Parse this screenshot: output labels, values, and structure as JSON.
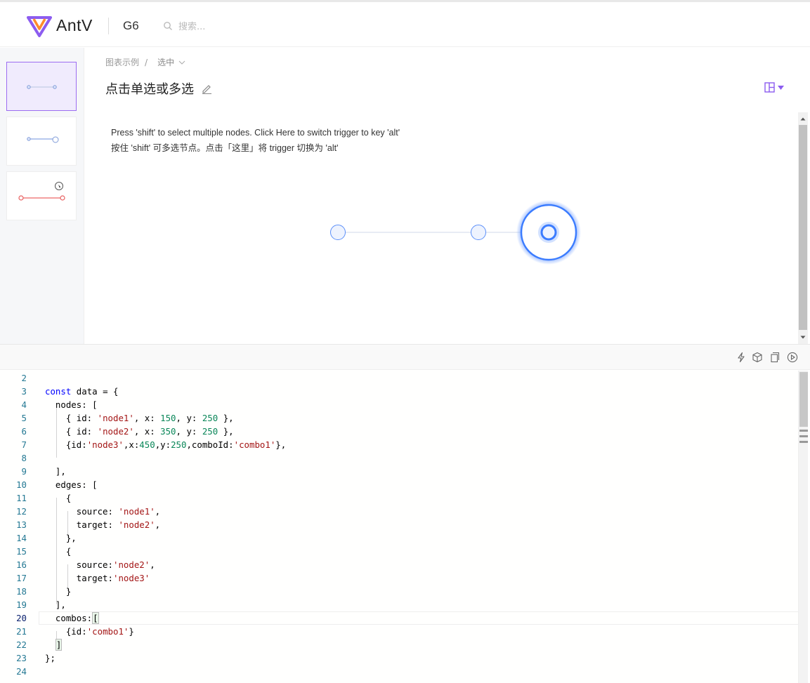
{
  "header": {
    "brand": "AntV",
    "product": "G6",
    "search_placeholder": "搜索..."
  },
  "breadcrumb": {
    "root": "图表示例",
    "separator": "/",
    "current": "选中"
  },
  "page_title": "点击单选或多选",
  "description": {
    "line1": "Press 'shift' to select multiple nodes. Click Here to switch trigger to key 'alt'",
    "line2": "按住 'shift' 可多选节点。点击「这里」将 trigger 切换为 'alt'"
  },
  "colors": {
    "accent": "#8c5cf0",
    "node_stroke": "#5b8ff9",
    "node_fill": "#eef3fe",
    "selected_stroke": "#3b7cff",
    "edge": "#d0dae8"
  },
  "toolbar_icons": [
    "lightning-icon",
    "cube-icon",
    "copy-icon",
    "play-icon"
  ],
  "code": {
    "current_line": "20",
    "lines": [
      {
        "n": "2",
        "t": ""
      },
      {
        "n": "3",
        "t": "const data = {"
      },
      {
        "n": "4",
        "t": "  nodes: ["
      },
      {
        "n": "5",
        "t": "    { id: 'node1', x: 150, y: 250 },"
      },
      {
        "n": "6",
        "t": "    { id: 'node2', x: 350, y: 250 },"
      },
      {
        "n": "7",
        "t": "    {id:'node3',x:450,y:250,comboId:'combo1'},"
      },
      {
        "n": "8",
        "t": ""
      },
      {
        "n": "9",
        "t": "  ],"
      },
      {
        "n": "10",
        "t": "  edges: ["
      },
      {
        "n": "11",
        "t": "    {"
      },
      {
        "n": "12",
        "t": "      source: 'node1',"
      },
      {
        "n": "13",
        "t": "      target: 'node2',"
      },
      {
        "n": "14",
        "t": "    },"
      },
      {
        "n": "15",
        "t": "    {"
      },
      {
        "n": "16",
        "t": "      source:'node2',"
      },
      {
        "n": "17",
        "t": "      target:'node3'"
      },
      {
        "n": "18",
        "t": "    }"
      },
      {
        "n": "19",
        "t": "  ],"
      },
      {
        "n": "20",
        "t": "  combos:["
      },
      {
        "n": "21",
        "t": "    {id:'combo1'}"
      },
      {
        "n": "22",
        "t": "  ]"
      },
      {
        "n": "23",
        "t": "};"
      },
      {
        "n": "24",
        "t": ""
      }
    ]
  }
}
